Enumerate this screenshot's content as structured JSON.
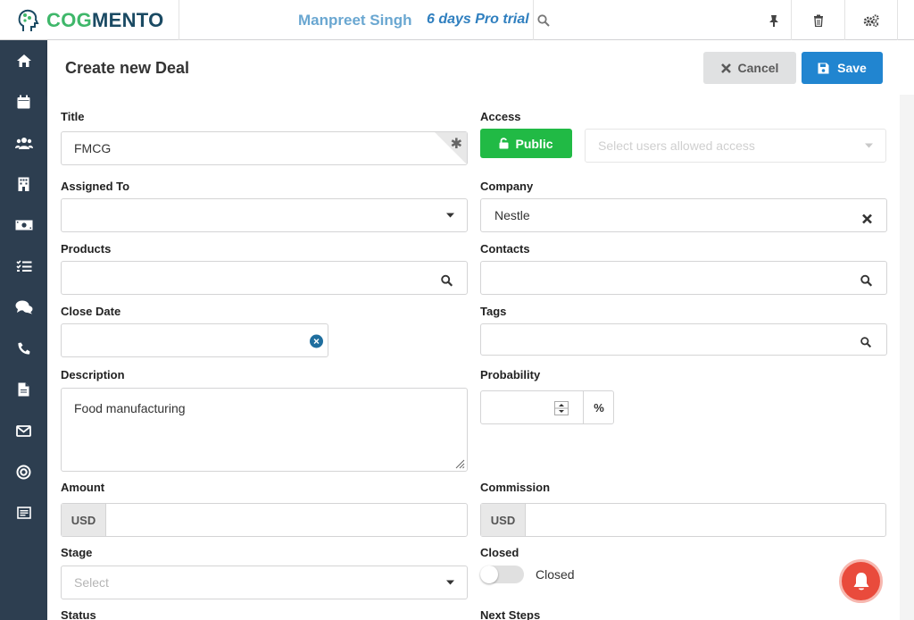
{
  "app": {
    "logo_text_a": "COG",
    "logo_text_b": "MENTO",
    "user_name": "Manpreet Singh",
    "trial_text": "6 days Pro trial"
  },
  "sidebar": {
    "items": [
      {
        "icon": "home-icon"
      },
      {
        "icon": "calendar-icon"
      },
      {
        "icon": "contacts-icon"
      },
      {
        "icon": "company-icon"
      },
      {
        "icon": "deals-money-icon"
      },
      {
        "icon": "tasks-icon"
      },
      {
        "icon": "cases-chat-icon"
      },
      {
        "icon": "phone-icon"
      },
      {
        "icon": "documents-icon"
      },
      {
        "icon": "email-icon"
      },
      {
        "icon": "campaigns-icon"
      },
      {
        "icon": "forms-icon"
      }
    ]
  },
  "header": {
    "title": "Create new Deal",
    "cancel_label": "Cancel",
    "save_label": "Save"
  },
  "form": {
    "title_label": "Title",
    "title_value": "FMCG",
    "access_label": "Access",
    "public_label": "Public",
    "access_users_placeholder": "Select users allowed access",
    "assigned_label": "Assigned To",
    "company_label": "Company",
    "company_value": "Nestle",
    "products_label": "Products",
    "contacts_label": "Contacts",
    "close_date_label": "Close Date",
    "tags_label": "Tags",
    "description_label": "Description",
    "description_value": "Food manufacturing",
    "probability_label": "Probability",
    "percent_symbol": "%",
    "amount_label": "Amount",
    "amount_currency": "USD",
    "commission_label": "Commission",
    "commission_currency": "USD",
    "stage_label": "Stage",
    "stage_placeholder": "Select",
    "closed_label": "Closed",
    "closed_toggle_label": "Closed",
    "status_label": "Status",
    "next_steps_label": "Next Steps"
  },
  "colors": {
    "sidebar_bg": "#2d3e50",
    "save_blue": "#2185d0",
    "public_green": "#21ba45",
    "notif_red": "#e94b3c"
  }
}
